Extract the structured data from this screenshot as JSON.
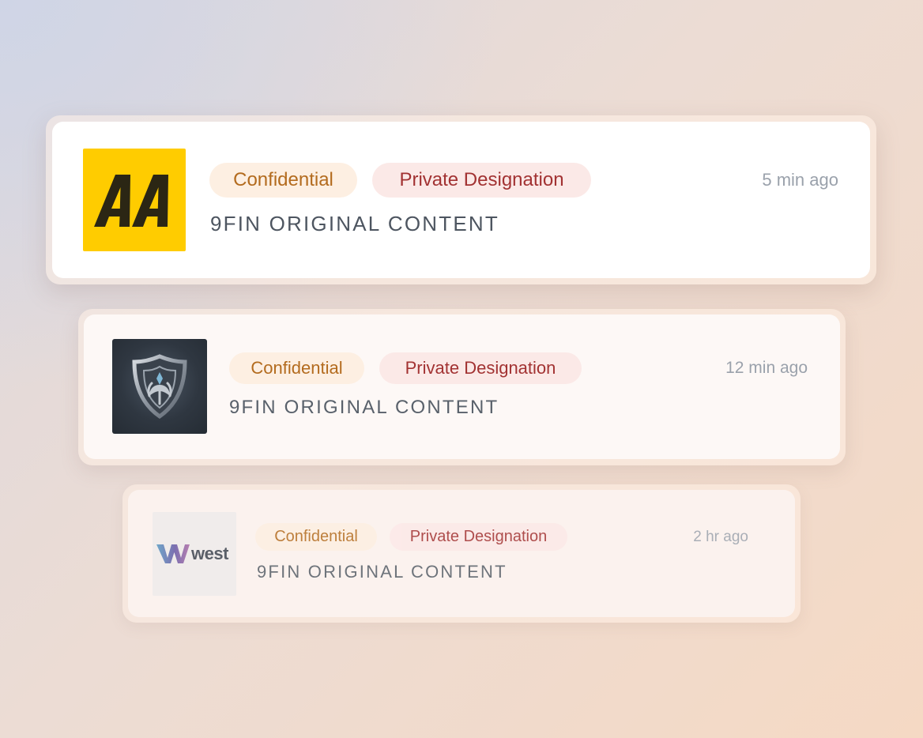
{
  "notifications": [
    {
      "logo": {
        "icon": "aa-logo-icon",
        "text": "AA",
        "color": "#ffcc00"
      },
      "badges": {
        "confidential": "Confidential",
        "private": "Private Designation"
      },
      "subtitle": "9FIN ORIGINAL CONTENT",
      "time": "5 min ago"
    },
    {
      "logo": {
        "icon": "shield-logo-icon",
        "color": "#2f3741"
      },
      "badges": {
        "confidential": "Confidential",
        "private": "Private Designation"
      },
      "subtitle": "9FIN ORIGINAL CONTENT",
      "time": "12 min ago"
    },
    {
      "logo": {
        "icon": "west-logo-icon",
        "text": "west"
      },
      "badges": {
        "confidential": "Confidential",
        "private": "Private Designation"
      },
      "subtitle": "9FIN ORIGINAL CONTENT",
      "time": "2 hr ago"
    }
  ],
  "colors": {
    "confidential_text": "#b36b1e",
    "confidential_bg": "#fdefe2",
    "private_text": "#a23232",
    "private_bg": "#fbe9e7",
    "aa_yellow": "#ffcc00"
  }
}
